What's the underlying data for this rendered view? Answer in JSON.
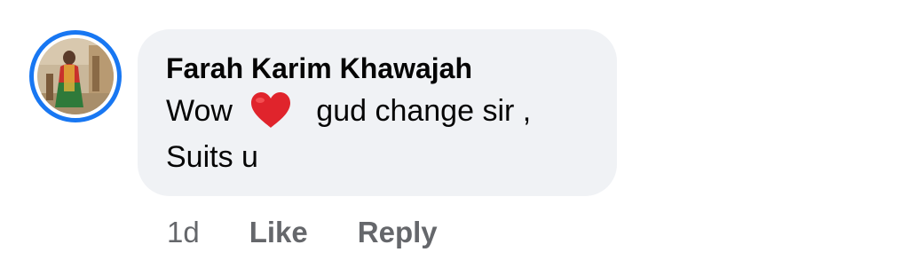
{
  "comment": {
    "author": "Farah Karim Khawajah",
    "text_before": "Wow ",
    "emoji_icon": "red-heart-icon",
    "text_after": "  gud change sir ,\nSuits u",
    "timestamp": "1d",
    "like_label": "Like",
    "reply_label": "Reply"
  },
  "colors": {
    "avatar_ring": "#1877f2",
    "bubble_bg": "#f0f2f5",
    "text": "#050505",
    "secondary_text": "#65676b",
    "heart": "#e0242c"
  }
}
